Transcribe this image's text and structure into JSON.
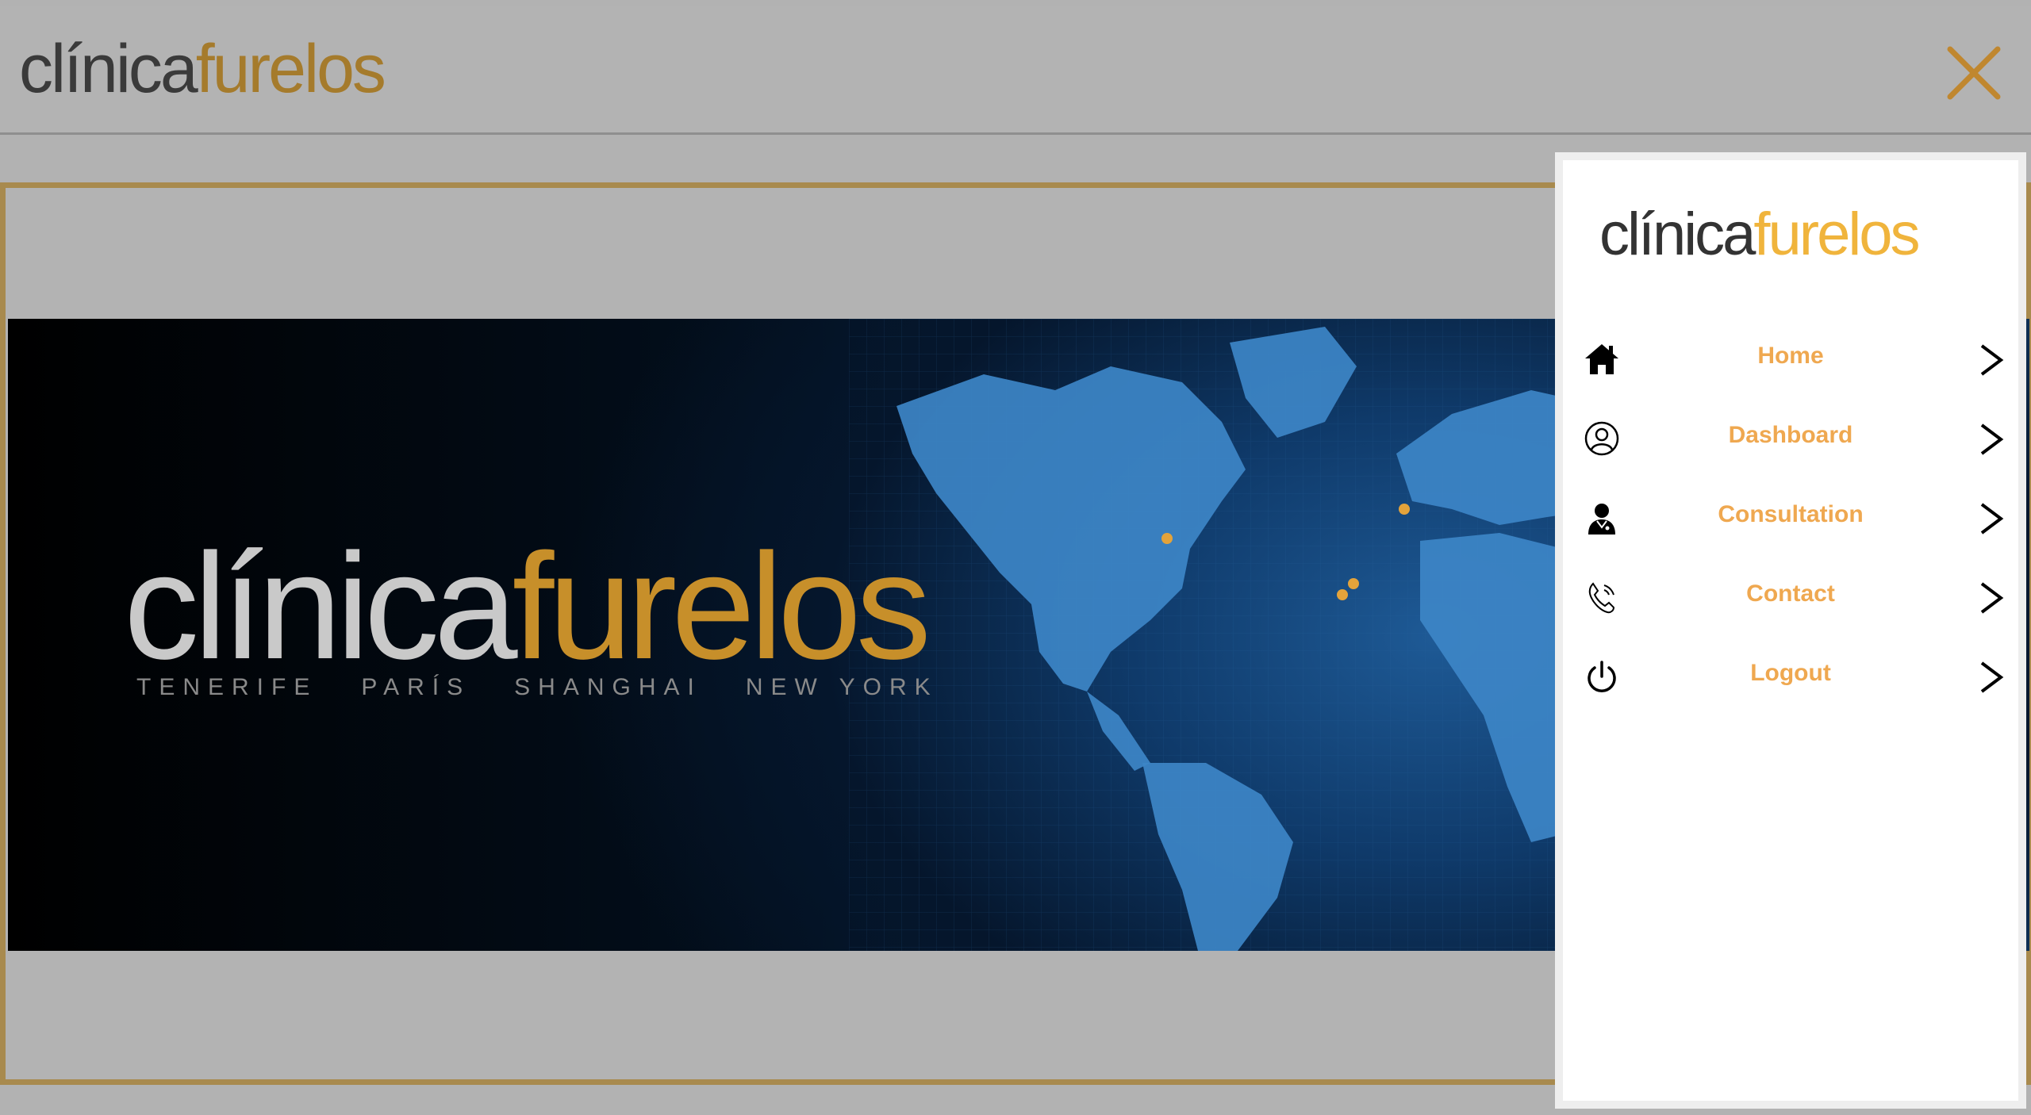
{
  "header": {
    "logo_part1": "clínica",
    "logo_part2": "furelos",
    "close_icon": "close-icon"
  },
  "banner": {
    "logo_part1": "clínica",
    "logo_part2": "furelos",
    "cities": "TENERIFE   PARÍS   SHANGHAI   NEW YORK"
  },
  "side_menu": {
    "logo_part1": "clínica",
    "logo_part2": "furelos",
    "items": [
      {
        "label": "Home",
        "icon": "home-icon"
      },
      {
        "label": "Dashboard",
        "icon": "user-circle-icon"
      },
      {
        "label": "Consultation",
        "icon": "doctor-icon"
      },
      {
        "label": "Contact",
        "icon": "phone-icon"
      },
      {
        "label": "Logout",
        "icon": "power-icon"
      }
    ]
  },
  "colors": {
    "accent_gold": "#a57b2c",
    "menu_label": "#efa850",
    "frame_border": "#a88a4e"
  }
}
